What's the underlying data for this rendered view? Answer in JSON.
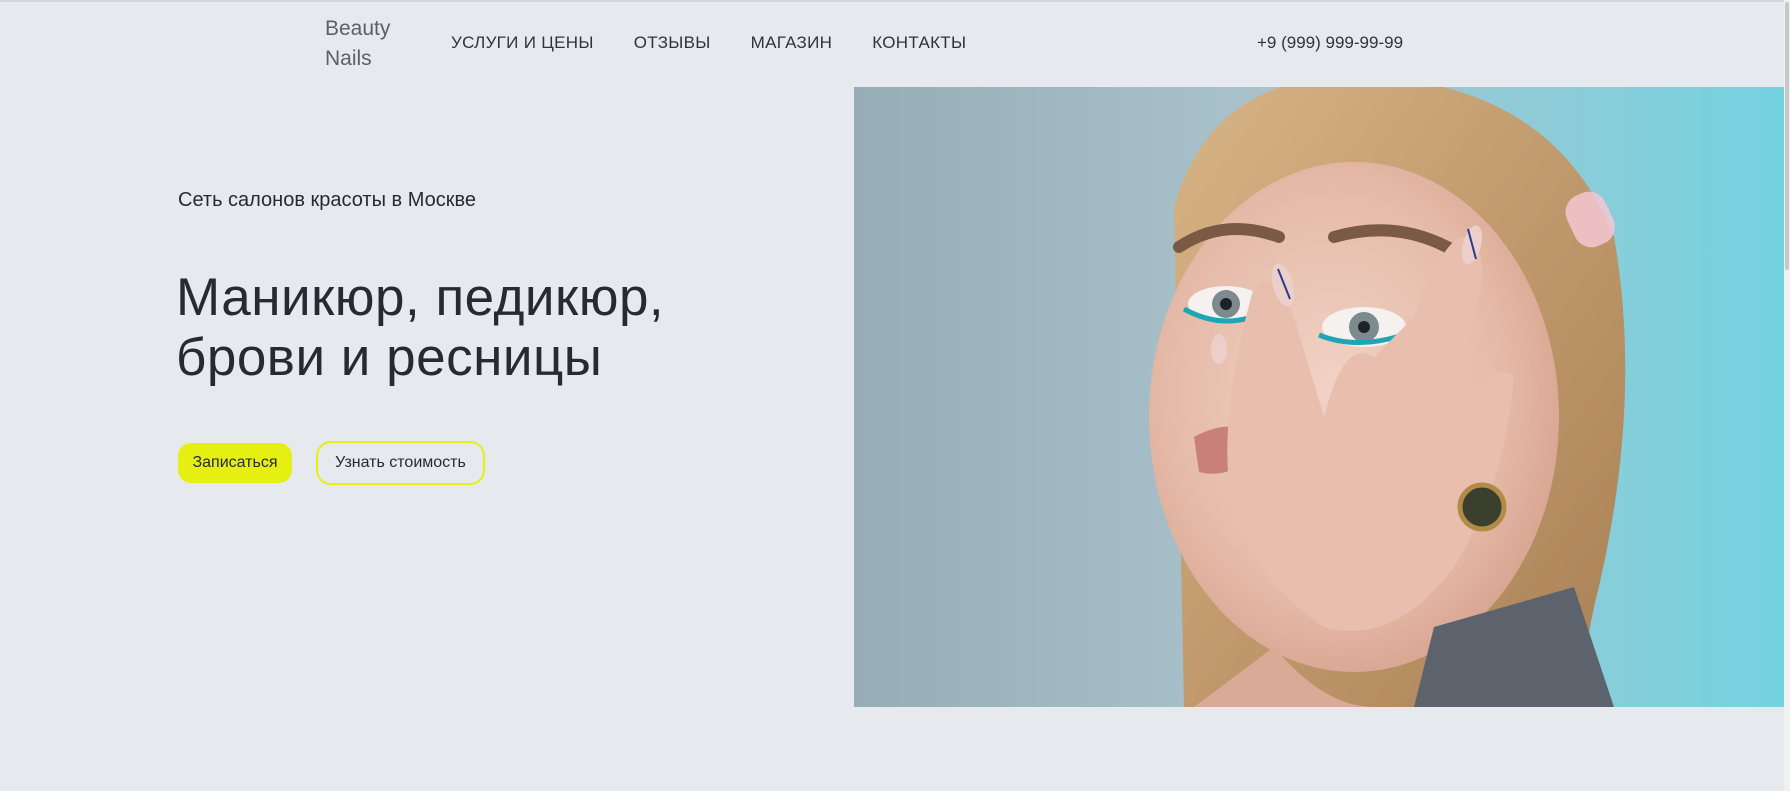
{
  "header": {
    "logo_line1": "Beauty",
    "logo_line2": "Nails",
    "nav": [
      {
        "label": "УСЛУГИ И ЦЕНЫ"
      },
      {
        "label": "ОТЗЫВЫ"
      },
      {
        "label": "МАГАЗИН"
      },
      {
        "label": "КОНТАКТЫ"
      }
    ],
    "phone": "+9 (999) 999-99-99"
  },
  "hero": {
    "tagline": "Сеть салонов красоты в Москве",
    "headline_line1": "Маникюр, педикюр,",
    "headline_line2": "брови и ресницы",
    "primary_button": "Записаться",
    "secondary_button": "Узнать стоимость",
    "photo_icon": "woman-portrait-photo"
  },
  "colors": {
    "background": "#e6e9ee",
    "accent": "#e6ef12",
    "text": "#262b33"
  }
}
